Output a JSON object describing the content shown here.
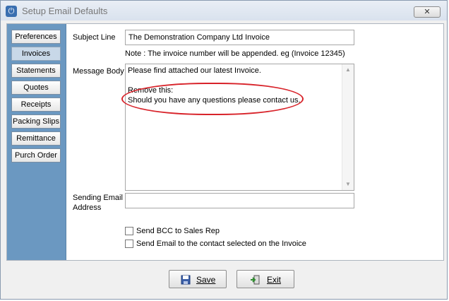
{
  "window": {
    "title": "Setup Email Defaults",
    "close_label": "✕"
  },
  "sidebar": {
    "items": [
      {
        "label": "Preferences"
      },
      {
        "label": "Invoices"
      },
      {
        "label": "Statements"
      },
      {
        "label": "Quotes"
      },
      {
        "label": "Receipts"
      },
      {
        "label": "Packing Slips"
      },
      {
        "label": "Remittance"
      },
      {
        "label": "Purch Order"
      }
    ],
    "active_index": 1
  },
  "form": {
    "subject_label": "Subject Line",
    "subject_value": "The Demonstration Company Ltd Invoice",
    "note": "Note : The invoice number will be appended. eg (Invoice 12345)",
    "message_label": "Message Body",
    "message_lines": [
      "Please find attached our latest Invoice.",
      "",
      "Remove this:",
      "Should you have any questions please contact us."
    ],
    "sending_label_1": "Sending Email",
    "sending_label_2": "Address",
    "sending_value": "",
    "bcc_label": "Send BCC to Sales Rep",
    "contact_label": "Send Email to the contact selected on the Invoice"
  },
  "buttons": {
    "save_label": "Save",
    "exit_label": "Exit"
  },
  "colors": {
    "sidebar": "#6b98c1",
    "annotation_circle": "#d8232a"
  }
}
